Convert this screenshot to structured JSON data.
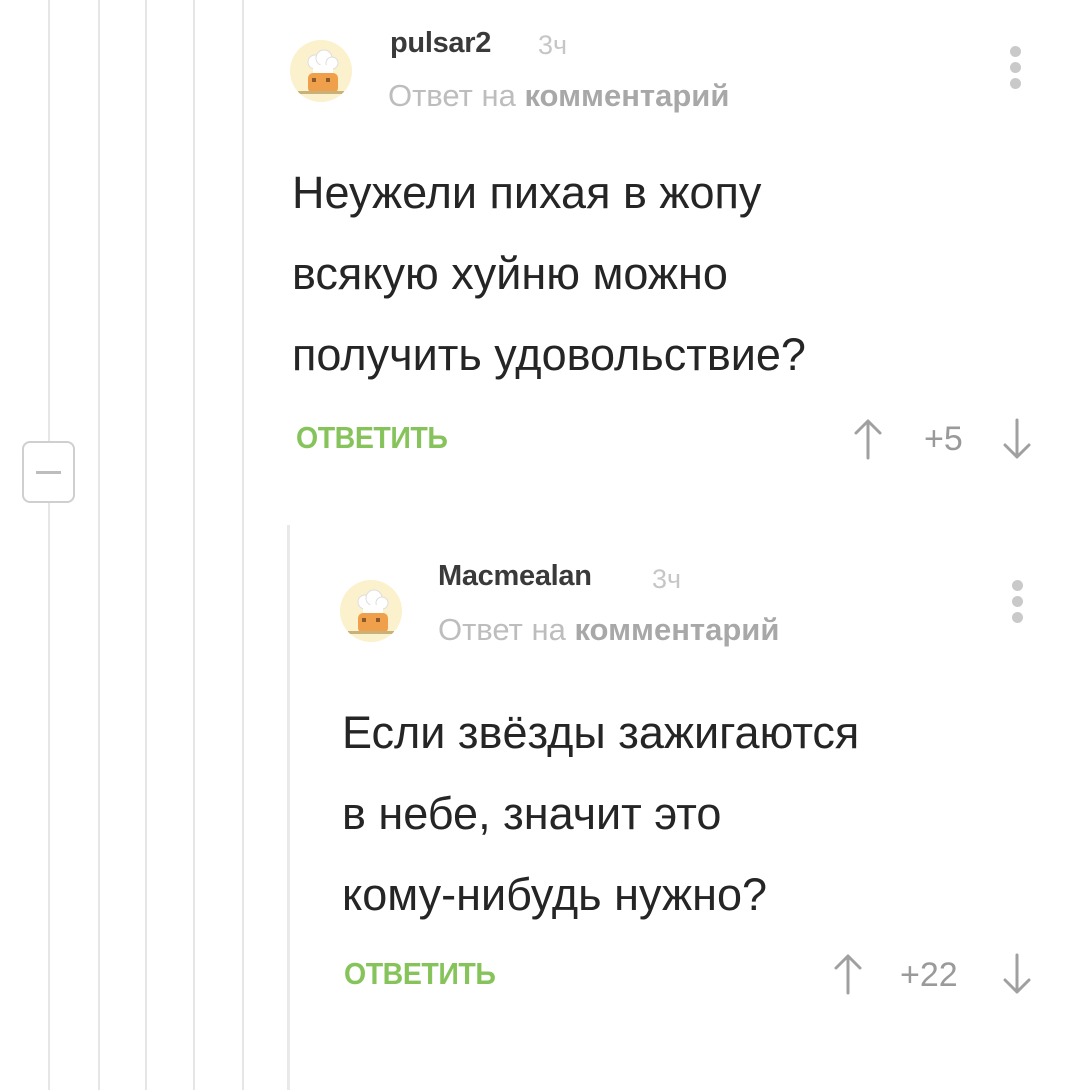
{
  "comments": [
    {
      "username": "pulsar2",
      "time": "3ч",
      "reply_prefix": "Ответ на",
      "reply_link": "комментарий",
      "text_lines": [
        "Неужели пихая в жопу",
        "всякую хуйню можно",
        "получить удовольствие?"
      ],
      "reply_label": "ОТВЕТИТЬ",
      "rating": "+5"
    },
    {
      "username": "Macmealan",
      "time": "3ч",
      "reply_prefix": "Ответ на",
      "reply_link": "комментарий",
      "text_lines": [
        "Если звёзды зажигаются",
        "в небе, значит это",
        "кому-нибудь нужно?"
      ],
      "reply_label": "ОТВЕТИТЬ",
      "rating": "+22"
    }
  ],
  "icons": {
    "avatar": "chef-hat-avatar-icon",
    "more": "more-vertical-icon",
    "vote_up": "arrow-up-icon",
    "vote_down": "arrow-down-icon",
    "collapse": "collapse-minus-icon"
  },
  "colors": {
    "accent_green": "#86c45b",
    "text": "#252525",
    "muted": "#bdbdbd"
  }
}
